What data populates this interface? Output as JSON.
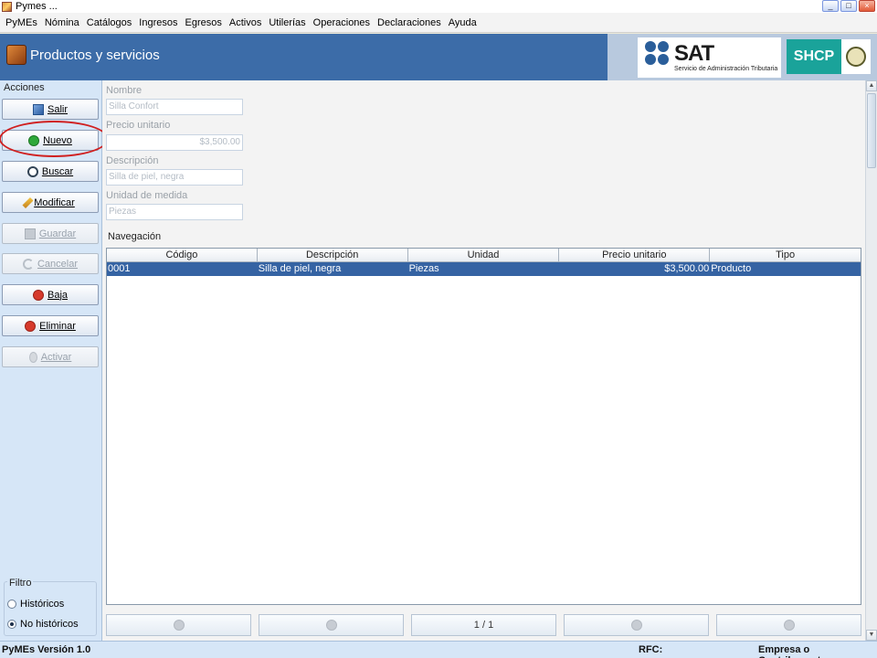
{
  "window": {
    "title": "Pymes ...",
    "controls": [
      "_",
      "□",
      "×"
    ]
  },
  "menubar": {
    "items": [
      "PyMEs",
      "Nómina",
      "Catálogos",
      "Ingresos",
      "Egresos",
      "Activos",
      "Utilerías",
      "Operaciones",
      "Declaraciones",
      "Ayuda"
    ]
  },
  "header": {
    "title": "Productos y servicios",
    "sat": "SAT",
    "sat_sub": "Servicio de Administración Tributaria",
    "shcp": "SHCP"
  },
  "actions": {
    "label": "Acciones",
    "buttons": [
      {
        "label": "Salir",
        "enabled": true,
        "icon": "exit-icon"
      },
      {
        "label": "Nuevo",
        "enabled": true,
        "icon": "add-icon"
      },
      {
        "label": "Buscar",
        "enabled": true,
        "icon": "search-icon"
      },
      {
        "label": "Modificar",
        "enabled": true,
        "icon": "pencil-icon"
      },
      {
        "label": "Guardar",
        "enabled": false,
        "icon": "save-icon"
      },
      {
        "label": "Cancelar",
        "enabled": false,
        "icon": "undo-icon"
      },
      {
        "label": "Baja",
        "enabled": true,
        "icon": "close-icon"
      },
      {
        "label": "Eliminar",
        "enabled": true,
        "icon": "delete-icon"
      },
      {
        "label": "Activar",
        "enabled": false,
        "icon": "bulb-icon"
      }
    ]
  },
  "filter": {
    "label": "Filtro",
    "options": [
      "Históricos",
      "No históricos"
    ],
    "selected": "No históricos"
  },
  "form": {
    "nombre": {
      "label": "Nombre",
      "value": "Silla Confort"
    },
    "precio": {
      "label": "Precio unitario",
      "value": "$3,500.00"
    },
    "descripcion": {
      "label": "Descripción",
      "value": "Silla de piel, negra"
    },
    "unidad": {
      "label": "Unidad de medida",
      "value": "Piezas"
    }
  },
  "navigation": {
    "label": "Navegación",
    "columns": [
      "Código",
      "Descripción",
      "Unidad",
      "Precio unitario",
      "Tipo"
    ],
    "rows": [
      {
        "codigo": "0001",
        "descripcion": "Silla de piel, negra",
        "unidad": "Piezas",
        "precio": "$3,500.00",
        "tipo": "Producto"
      }
    ],
    "page": "1 / 1"
  },
  "status": {
    "version": "PyMEs Versión 1.0",
    "rfc": "RFC:",
    "empresa": "Empresa o Contribuyente:"
  },
  "colors": {
    "header": "#3c6ca8",
    "selection": "#3563a3",
    "panel": "#d6e6f7",
    "annotation": "#d02020"
  }
}
